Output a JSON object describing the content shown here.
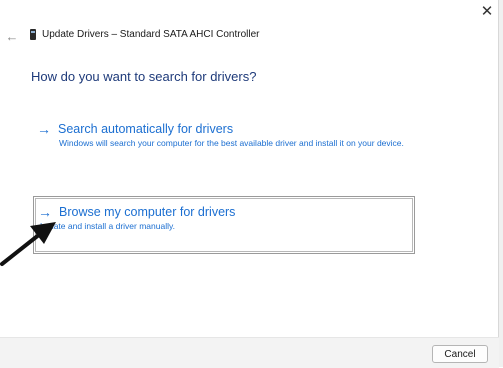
{
  "window": {
    "title": "Update Drivers – Standard SATA AHCI Controller",
    "close_glyph": "✕",
    "back_glyph": "←"
  },
  "main": {
    "heading": "How do you want to search for drivers?",
    "options": [
      {
        "arrow_glyph": "→",
        "title": "Search automatically for drivers",
        "description": "Windows will search your computer for the best available driver and install it on your device."
      },
      {
        "arrow_glyph": "→",
        "title": "Browse my computer for drivers",
        "description": "Locate and install a driver manually."
      }
    ]
  },
  "footer": {
    "cancel_label": "Cancel"
  },
  "icons": {
    "close": "close-icon",
    "back": "back-arrow-icon",
    "device": "device-icon",
    "option_arrow": "arrow-right-icon",
    "annotation": "pointer-arrow-icon"
  },
  "colors": {
    "link_blue": "#1c6fd1",
    "heading_blue": "#1e3a7a",
    "footer_bg": "#f3f3f3",
    "annotation_arrow": "#111111"
  }
}
